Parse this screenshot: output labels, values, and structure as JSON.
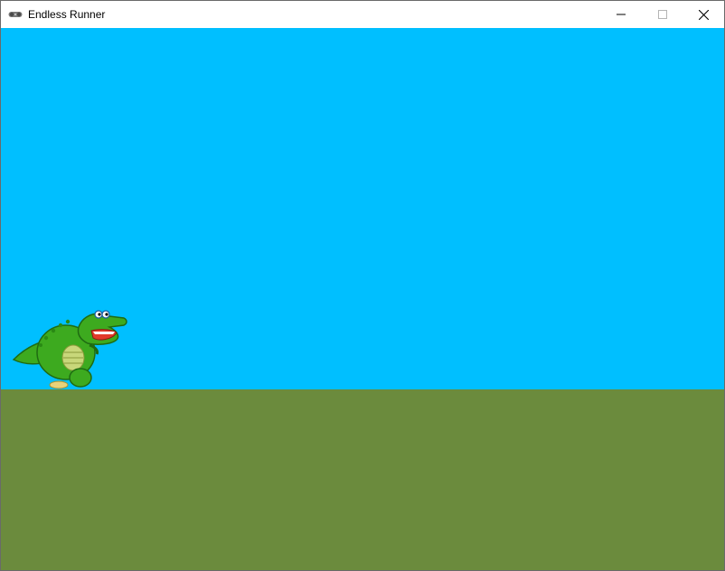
{
  "window": {
    "title": "Endless Runner",
    "icon": "gamepad-icon"
  },
  "titlebar_controls": {
    "minimize": "minimize-icon",
    "maximize": "maximize-icon",
    "close": "close-icon"
  },
  "game": {
    "sky_color": "#00BFFF",
    "ground_color": "#6B8B3D",
    "player": {
      "sprite": "green-dinosaur",
      "body_color": "#3DAA1F",
      "belly_color": "#C8D77A",
      "mouth_color": "#E23A2A"
    }
  }
}
